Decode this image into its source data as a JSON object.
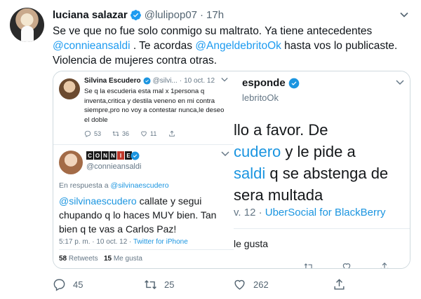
{
  "tweet": {
    "author_name": "luciana salazar",
    "author_handle": "@lulipop07",
    "separator": "·",
    "time": "17h",
    "text_parts": {
      "p1": "Se ve que no fue solo conmigo su maltrato. Ya tiene antecedentes ",
      "m1": "@connieansaldi",
      "p2": " . Te acordas ",
      "m2": "@AngeldebritoOk",
      "p3": " hasta vos lo publicaste. Violencia de mujeres contra otras."
    },
    "icons": [
      "verified-icon",
      "chevron-down-icon"
    ],
    "accent_color": "#1d9bf0"
  },
  "quote_left": {
    "first": {
      "name": "Silvina Escudero",
      "handle": "@silvi...",
      "separator": "·",
      "date": "10 oct. 12",
      "body": "Se q la escuderia esta mal x 1persona q inventa,critica y destila veneno en mi contra siempre,pro no voy a contestar nunca,le deseo el doble",
      "replies": "53",
      "retweets": "36",
      "likes": "11"
    },
    "second": {
      "badge_letters": [
        "C",
        "O",
        "N",
        "N",
        "I",
        "E"
      ],
      "handle": "@connieansaldi",
      "reply_prefix": "En respuesta a ",
      "reply_to": "@silvinaescudero",
      "body_mention": "@silvinaescudero",
      "body_text": " callate y segui chupando q lo haces MUY bien. Tan bien q te vas a Carlos Paz!",
      "time": "5:17 p. m. · 10 oct. 12 · ",
      "client": "Twitter for iPhone",
      "retweets_count": "58",
      "retweets_label": " Retweets",
      "likes_count": "15",
      "likes_label": " Me gusta"
    }
  },
  "quote_right": {
    "header": "esponde",
    "handle": "lebritoOk",
    "line1": "llo a favor. De",
    "line2_mention": "cudero",
    "line2_text": " y le pide a",
    "line3_mention": "saldi",
    "line3_text": " q se abstenga de",
    "line4": "sera multada",
    "time": "v. 12 · ",
    "client": "UberSocial for BlackBerry",
    "likes_label": "le gusta"
  },
  "actions": {
    "replies": "45",
    "retweets": "25",
    "likes": "262"
  }
}
